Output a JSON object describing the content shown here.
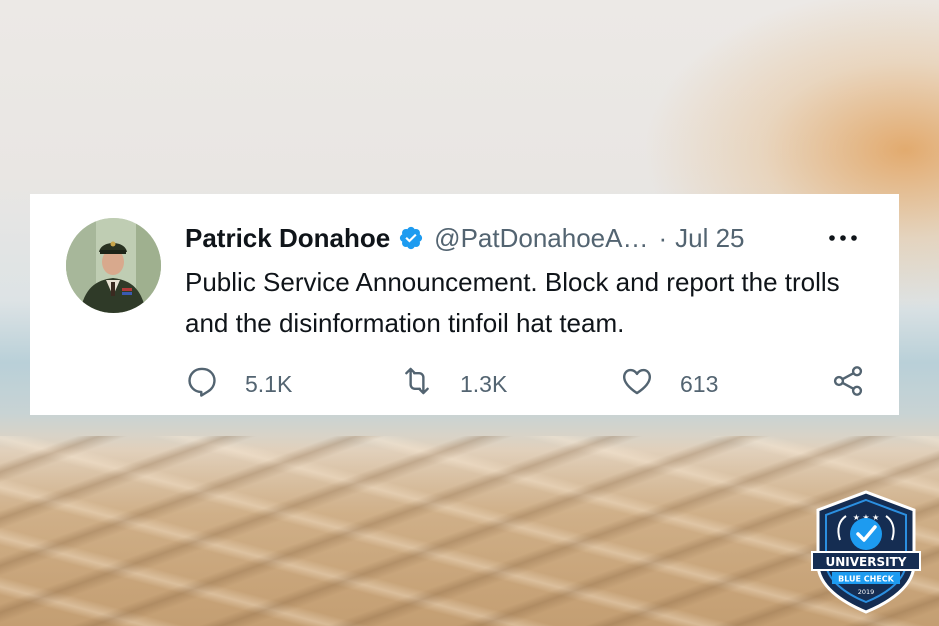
{
  "tweet": {
    "author_name": "Patrick Donahoe",
    "handle": "@PatDonahoeA…",
    "separator": "·",
    "date": "Jul 25",
    "text": "Public Service Announcement.  Block and report the trolls and the disinformation tinfoil hat team.",
    "replies": "5.1K",
    "retweets": "1.3K",
    "likes": "613"
  },
  "badge": {
    "line1": "UNIVERSITY",
    "line2": "BLUE CHECK",
    "year": "2019"
  },
  "colors": {
    "verified_blue": "#1d9bf0",
    "text": "#0f1419",
    "muted": "#536471",
    "badge_navy": "#152d52"
  },
  "icons": {
    "verified": "verified-badge-icon",
    "more": "more-icon",
    "reply": "reply-icon",
    "retweet": "retweet-icon",
    "like": "heart-icon",
    "share": "share-icon"
  }
}
